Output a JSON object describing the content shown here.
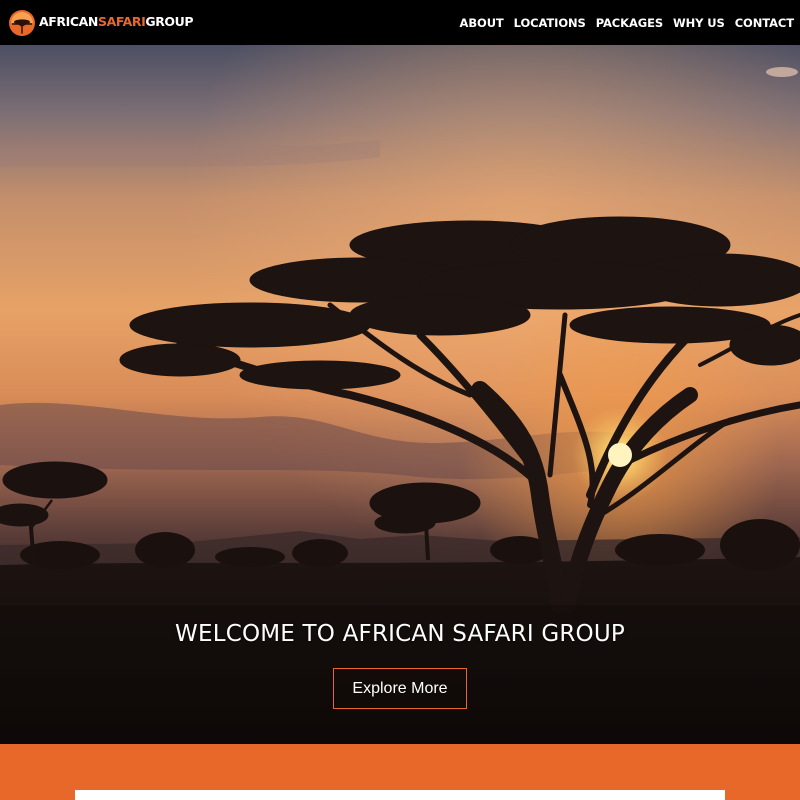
{
  "brand": {
    "word1": "AFRICAN",
    "word2": "SAFARI",
    "word3": "GROUP",
    "logo_icon": "safari-logo-icon"
  },
  "nav": {
    "items": [
      {
        "label": "ABOUT"
      },
      {
        "label": "LOCATIONS"
      },
      {
        "label": "PACKAGES"
      },
      {
        "label": "WHY US"
      },
      {
        "label": "CONTACT"
      }
    ]
  },
  "hero": {
    "title": "WELCOME TO AFRICAN SAFARI GROUP",
    "button_label": "Explore More",
    "image": "acacia-tree-sunset-image"
  },
  "colors": {
    "accent": "#e8682a",
    "navbar": "#000000",
    "text": "#ffffff"
  }
}
